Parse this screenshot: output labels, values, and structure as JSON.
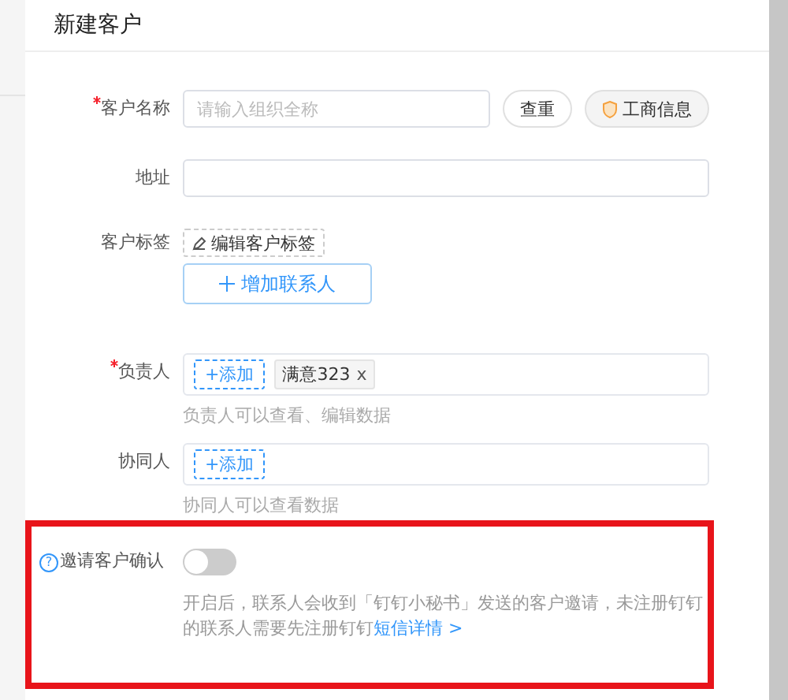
{
  "title": "新建客户",
  "customer_name": {
    "label": "客户名称",
    "required": true,
    "placeholder": "请输入组织全称",
    "buttons": [
      {
        "label": "查重",
        "kind": "plain"
      },
      {
        "label": "工商信息",
        "kind": "info"
      }
    ]
  },
  "address": {
    "label": "地址",
    "required": false
  },
  "tags": {
    "label": "客户标签",
    "button": "编辑客户标签"
  },
  "add_contact": "增加联系人",
  "owner": {
    "label": "负责人",
    "required": true,
    "add": "+添加",
    "people": [
      {
        "name": "满意323",
        "remove": "x"
      }
    ],
    "hint": "负责人可以查看、编辑数据"
  },
  "collaborator": {
    "label": "协同人",
    "required": false,
    "add": "+添加",
    "hint": "协同人可以查看数据"
  },
  "invite": {
    "label": "邀请客户确认",
    "help": "?",
    "on": false,
    "highlighted": true,
    "description": "开启后，联系人会收到「钉钉小秘书」发送的客户邀请，未注册钉钉的联系人需要先注册钉钉",
    "link": "短信详情 >"
  }
}
